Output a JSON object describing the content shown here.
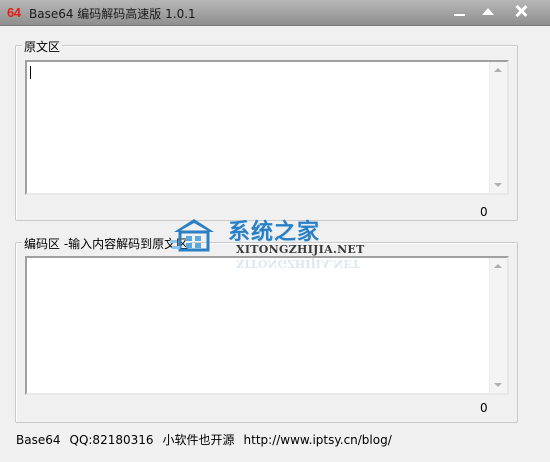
{
  "window": {
    "app_icon_text": "64",
    "title": "Base64 编码解码高速版 1.0.1"
  },
  "source_group": {
    "legend": "原文区",
    "text_value": "",
    "char_count": "0"
  },
  "encode_group": {
    "legend": "编码区 -输入内容解码到原文区",
    "text_value": "",
    "char_count": "0"
  },
  "status": {
    "app_name": "Base64",
    "qq": "QQ:82180316",
    "slogan": "小软件也开源",
    "url": "http://www.iptsy.cn/blog/"
  },
  "watermark": {
    "title": "系统之家",
    "subtitle": "XITONGZHIJIA.NET"
  },
  "colors": {
    "titlebar": "#a3a3a3",
    "icon_red": "#e0201b",
    "watermark_blue": "#2b7fc4"
  }
}
